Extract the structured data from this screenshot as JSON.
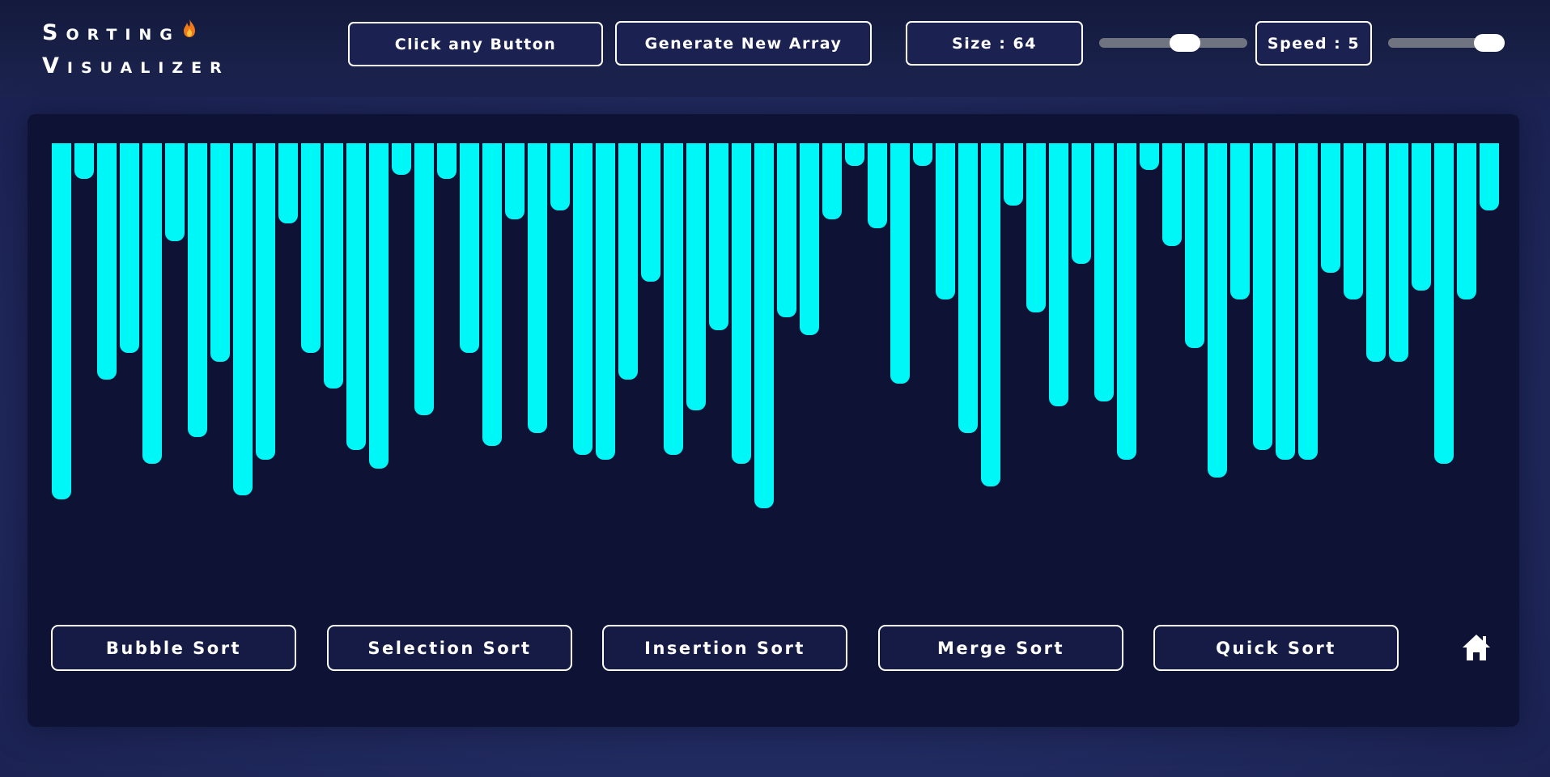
{
  "app": {
    "title_line1": "Sorting",
    "title_line2": "Visualizer",
    "flame_icon": "flame-icon"
  },
  "header": {
    "status_label": "Click any Button",
    "generate_label": "Generate New Array",
    "size_label": "Size : 64",
    "size_slider_value": 0.6,
    "speed_label": "Speed : 5",
    "speed_slider_value": 1.0
  },
  "array": {
    "color": "#00f7f7",
    "values": [
      80,
      8,
      53,
      47,
      72,
      22,
      66,
      49,
      79,
      71,
      18,
      47,
      55,
      69,
      73,
      7,
      61,
      8,
      47,
      68,
      17,
      65,
      15,
      70,
      71,
      53,
      31,
      70,
      60,
      42,
      72,
      82,
      39,
      43,
      17,
      5,
      19,
      54,
      5,
      35,
      65,
      77,
      14,
      38,
      59,
      27,
      58,
      71,
      6,
      23,
      46,
      75,
      35,
      69,
      71,
      71,
      29,
      35,
      49,
      49,
      33,
      72,
      35,
      15
    ]
  },
  "sorts": {
    "bubble": "Bubble Sort",
    "selection": "Selection Sort",
    "insertion": "Insertion Sort",
    "merge": "Merge Sort",
    "quick": "Quick Sort"
  },
  "nav": {
    "home_icon": "home-icon"
  },
  "colors": {
    "background": "#232d63",
    "panel": "#0e1336",
    "bar": "#00f7f7",
    "button_border": "#ffffff"
  }
}
